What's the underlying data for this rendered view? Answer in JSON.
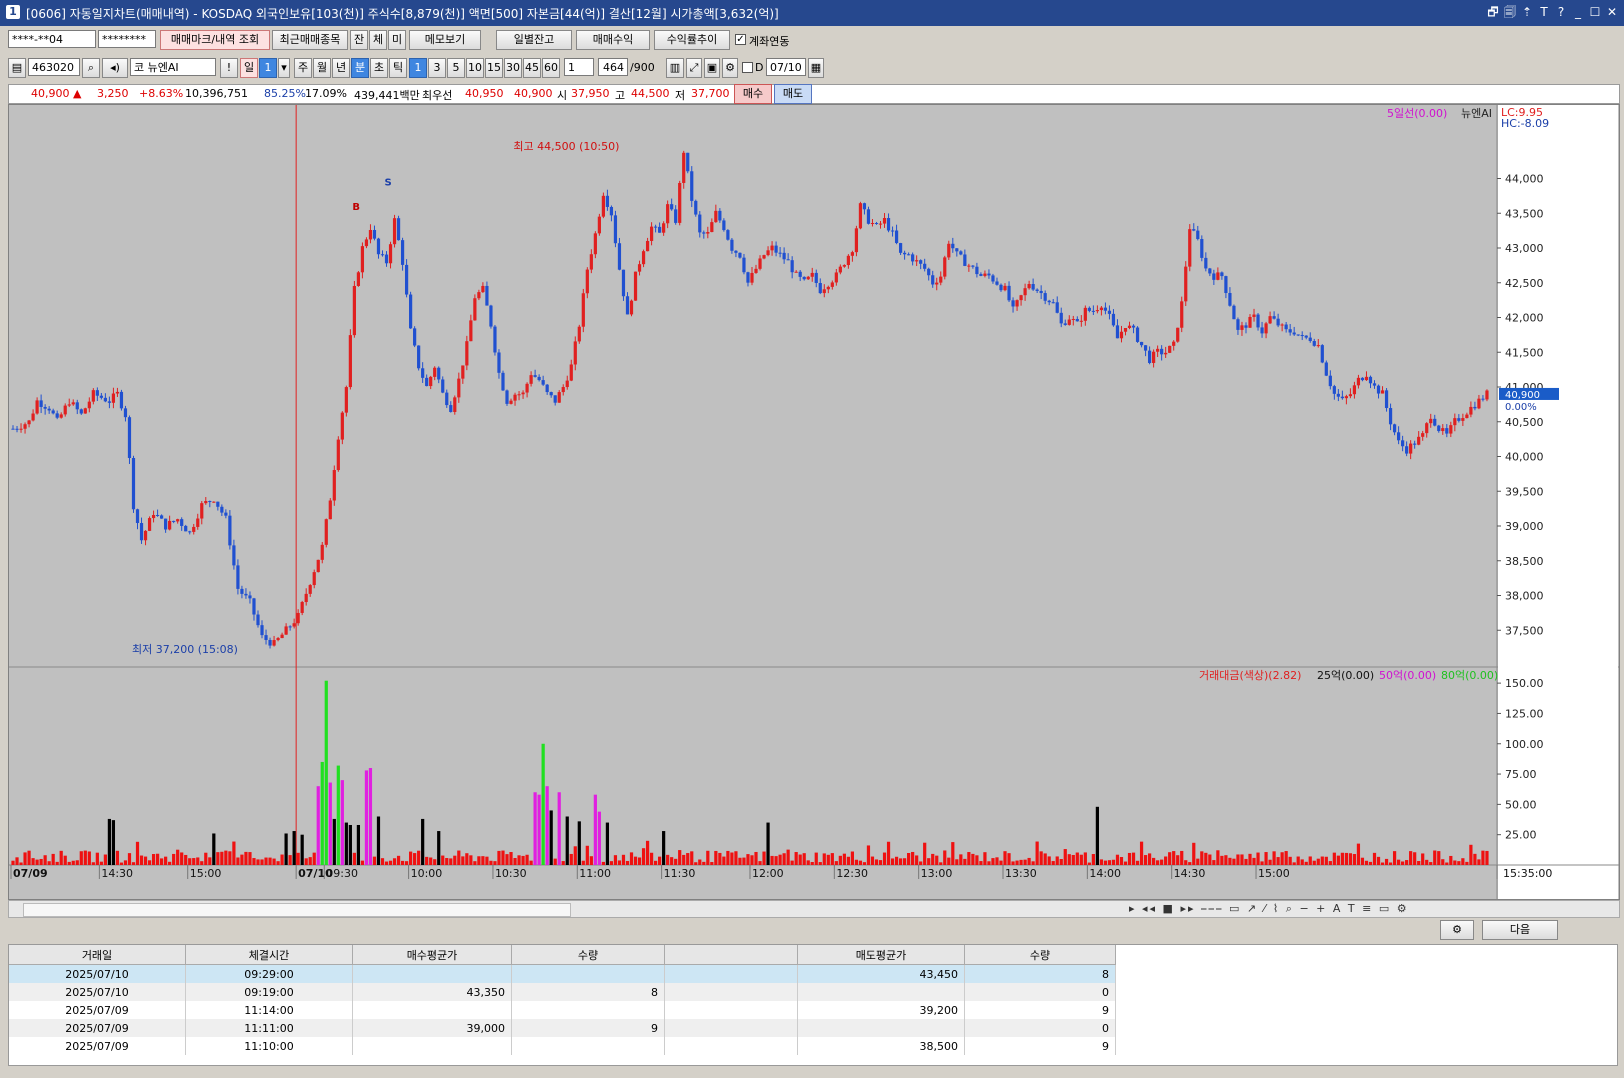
{
  "window": {
    "icon": "1",
    "title": "[0606] 자동일지차트(매매내역) - KOSDAQ 외국인보유[103(천)] 주식수[8,879(천)] 액면[500] 자본금[44(억)] 결산[12월] 시가총액[3,632(억)]",
    "buttons": [
      "🗗",
      "🗐",
      "⇡",
      "T",
      "?",
      "_",
      "☐",
      "✕"
    ]
  },
  "toolbar1": {
    "account": "****-**04",
    "password": "********",
    "mark_button": "매매마크/내역 조회",
    "recent_button": "최근매매종목",
    "small_tabs": [
      "잔",
      "체",
      "미"
    ],
    "memo_button": "메모보기",
    "daily_balance": "일별잔고",
    "trade_profit": "매매수익",
    "profit_trend": "수익률추이",
    "link_checkbox": "계좌연동",
    "link_checked": true
  },
  "toolbar2": {
    "code": "463020",
    "market": "코",
    "name": "뉴엔AI",
    "excl": "!",
    "day": "일",
    "n1": "1",
    "periods": [
      "주",
      "월",
      "년",
      "분",
      "초",
      "틱"
    ],
    "selected_period": "분",
    "minutes": [
      "1",
      "3",
      "5",
      "10",
      "15",
      "30",
      "45",
      "60"
    ],
    "selected_minute": "1",
    "count": "1",
    "display": "464",
    "display_total": "/900",
    "d_label": "D",
    "date": "07/10"
  },
  "quote": {
    "price": "40,900 ▲",
    "change": "3,250",
    "pct": "+8.63%",
    "volume": "10,396,751",
    "ratio": "85.25%",
    "turnover": "17.09%",
    "amount": "439,441백만",
    "best_label": "최우선",
    "bid": "40,950",
    "ask": "40,900",
    "open_label": "시",
    "open": "37,950",
    "high_label": "고",
    "high": "44,500",
    "low_label": "저",
    "low": "37,700",
    "buy_button": "매수",
    "sell_button": "매도"
  },
  "chart_data": [
    {
      "type": "candlestick",
      "title": "",
      "series": [
        {
          "name": "뉴엔AI"
        }
      ],
      "legend": [
        "5일선(0.00)",
        "뉴엔AI"
      ],
      "indicators": [
        "LC:9.95",
        "HC:-8.09"
      ],
      "y_ticks": [
        "44,000",
        "43,500",
        "43,000",
        "42,500",
        "42,000",
        "41,500",
        "41,000",
        "40,500",
        "40,000",
        "39,500",
        "39,000",
        "38,500",
        "38,000",
        "37,500"
      ],
      "ylim": [
        37000,
        45000
      ],
      "last": "40,900",
      "last_pct": "0.00%",
      "annotations": [
        "최고 44,500 (10:50)",
        "최저 37,200 (15:08)"
      ],
      "markers": [
        "B",
        "S"
      ],
      "price_path": [
        [
          0,
          40400
        ],
        [
          4,
          40500
        ],
        [
          6,
          40800
        ],
        [
          9,
          40700
        ],
        [
          11,
          40500
        ],
        [
          14,
          40800
        ],
        [
          17,
          40600
        ],
        [
          20,
          40900
        ],
        [
          24,
          40800
        ],
        [
          26,
          40900
        ],
        [
          28,
          40600
        ],
        [
          30,
          39300
        ],
        [
          32,
          38800
        ],
        [
          35,
          39200
        ],
        [
          38,
          39000
        ],
        [
          41,
          39100
        ],
        [
          44,
          38900
        ],
        [
          47,
          39300
        ],
        [
          50,
          39400
        ],
        [
          53,
          39100
        ],
        [
          56,
          38100
        ],
        [
          59,
          37900
        ],
        [
          62,
          37400
        ],
        [
          65,
          37300
        ],
        [
          68,
          37500
        ],
        [
          71,
          37700
        ],
        [
          74,
          38200
        ],
        [
          77,
          38700
        ],
        [
          79,
          39400
        ],
        [
          81,
          40300
        ],
        [
          83,
          41000
        ],
        [
          85,
          42400
        ],
        [
          87,
          43000
        ],
        [
          89,
          43300
        ],
        [
          91,
          42900
        ],
        [
          93,
          42800
        ],
        [
          95,
          43400
        ],
        [
          97,
          42800
        ],
        [
          99,
          41800
        ],
        [
          101,
          41300
        ],
        [
          103,
          41000
        ],
        [
          105,
          41300
        ],
        [
          107,
          40900
        ],
        [
          109,
          40700
        ],
        [
          111,
          41100
        ],
        [
          113,
          41600
        ],
        [
          115,
          42300
        ],
        [
          117,
          42400
        ],
        [
          119,
          41900
        ],
        [
          121,
          41200
        ],
        [
          123,
          40800
        ],
        [
          125,
          40900
        ],
        [
          127,
          40900
        ],
        [
          129,
          41200
        ],
        [
          131,
          41100
        ],
        [
          133,
          40900
        ],
        [
          135,
          40800
        ],
        [
          137,
          41000
        ],
        [
          139,
          41300
        ],
        [
          141,
          41900
        ],
        [
          143,
          42700
        ],
        [
          145,
          43200
        ],
        [
          147,
          43800
        ],
        [
          149,
          43500
        ],
        [
          151,
          42700
        ],
        [
          153,
          42000
        ],
        [
          155,
          42600
        ],
        [
          157,
          43000
        ],
        [
          159,
          43300
        ],
        [
          161,
          43200
        ],
        [
          163,
          43600
        ],
        [
          165,
          43400
        ],
        [
          167,
          44400
        ],
        [
          169,
          43700
        ],
        [
          171,
          43200
        ],
        [
          173,
          43200
        ],
        [
          175,
          43500
        ],
        [
          177,
          43300
        ],
        [
          179,
          43000
        ],
        [
          181,
          42900
        ],
        [
          183,
          42500
        ],
        [
          185,
          42700
        ],
        [
          187,
          42900
        ],
        [
          189,
          43000
        ],
        [
          191,
          42900
        ],
        [
          193,
          42800
        ],
        [
          195,
          42600
        ],
        [
          197,
          42500
        ],
        [
          199,
          42600
        ],
        [
          201,
          42400
        ],
        [
          203,
          42500
        ],
        [
          205,
          42600
        ],
        [
          207,
          42800
        ],
        [
          209,
          43000
        ],
        [
          211,
          43600
        ],
        [
          213,
          43400
        ],
        [
          215,
          43300
        ],
        [
          217,
          43400
        ],
        [
          219,
          43200
        ],
        [
          221,
          42900
        ],
        [
          223,
          42900
        ],
        [
          225,
          42800
        ],
        [
          227,
          42700
        ],
        [
          229,
          42500
        ],
        [
          231,
          42600
        ],
        [
          233,
          43100
        ],
        [
          235,
          42900
        ],
        [
          237,
          42800
        ],
        [
          239,
          42700
        ],
        [
          241,
          42600
        ],
        [
          243,
          42600
        ],
        [
          245,
          42500
        ],
        [
          247,
          42400
        ],
        [
          249,
          42100
        ],
        [
          251,
          42300
        ],
        [
          253,
          42500
        ],
        [
          255,
          42400
        ],
        [
          257,
          42300
        ],
        [
          259,
          42200
        ],
        [
          261,
          41900
        ],
        [
          263,
          42000
        ],
        [
          265,
          41900
        ],
        [
          267,
          42100
        ],
        [
          269,
          42100
        ],
        [
          271,
          42200
        ],
        [
          273,
          42000
        ],
        [
          275,
          41700
        ],
        [
          277,
          41900
        ],
        [
          279,
          41800
        ],
        [
          281,
          41600
        ],
        [
          283,
          41400
        ],
        [
          285,
          41500
        ],
        [
          287,
          41500
        ],
        [
          289,
          41600
        ],
        [
          291,
          42200
        ],
        [
          293,
          43300
        ],
        [
          295,
          43100
        ],
        [
          297,
          42700
        ],
        [
          299,
          42600
        ],
        [
          301,
          42600
        ],
        [
          303,
          42200
        ],
        [
          305,
          41800
        ],
        [
          307,
          41900
        ],
        [
          309,
          42000
        ],
        [
          311,
          41800
        ],
        [
          313,
          42000
        ],
        [
          315,
          41900
        ],
        [
          317,
          41800
        ],
        [
          319,
          41800
        ],
        [
          321,
          41700
        ],
        [
          323,
          41700
        ],
        [
          325,
          41600
        ],
        [
          327,
          41200
        ],
        [
          329,
          40900
        ],
        [
          331,
          40800
        ],
        [
          333,
          40900
        ],
        [
          335,
          41100
        ],
        [
          337,
          41200
        ],
        [
          339,
          41000
        ],
        [
          341,
          40900
        ],
        [
          343,
          40500
        ],
        [
          345,
          40200
        ],
        [
          347,
          40100
        ],
        [
          349,
          40200
        ],
        [
          351,
          40300
        ],
        [
          353,
          40600
        ],
        [
          355,
          40400
        ],
        [
          357,
          40300
        ],
        [
          359,
          40500
        ],
        [
          361,
          40600
        ],
        [
          363,
          40700
        ],
        [
          365,
          40800
        ],
        [
          367,
          40900
        ]
      ],
      "x_labels": [
        "07/09",
        "14:30",
        "15:00",
        "07/10",
        "09:30",
        "10:00",
        "10:30",
        "11:00",
        "11:30",
        "12:00",
        "12:30",
        "13:00",
        "13:30",
        "14:00",
        "14:30",
        "15:00",
        "15:35:00"
      ]
    },
    {
      "type": "bar",
      "title": "",
      "legend": [
        "거래대금(색상)(2.82)",
        "25억(0.00)",
        "50억(0.00)",
        "80억(0.00)"
      ],
      "ylim": [
        0,
        160
      ],
      "y_ticks": [
        "150.00",
        "125.00",
        "100.00",
        "75.00",
        "50.00",
        "25.00"
      ],
      "spikes": [
        [
          24,
          38,
          "black"
        ],
        [
          25,
          37,
          "black"
        ],
        [
          50,
          26,
          "black"
        ],
        [
          68,
          26,
          "black"
        ],
        [
          70,
          28,
          "black"
        ],
        [
          72,
          25,
          "black"
        ],
        [
          76,
          65,
          "magenta"
        ],
        [
          77,
          85,
          "green"
        ],
        [
          78,
          152,
          "green"
        ],
        [
          79,
          68,
          "magenta"
        ],
        [
          80,
          38,
          "black"
        ],
        [
          81,
          82,
          "green"
        ],
        [
          82,
          70,
          "magenta"
        ],
        [
          83,
          35,
          "black"
        ],
        [
          84,
          33,
          "black"
        ],
        [
          86,
          33,
          "black"
        ],
        [
          88,
          78,
          "magenta"
        ],
        [
          89,
          80,
          "magenta"
        ],
        [
          91,
          40,
          "black"
        ],
        [
          102,
          38,
          "black"
        ],
        [
          106,
          28,
          "black"
        ],
        [
          130,
          60,
          "magenta"
        ],
        [
          131,
          58,
          "magenta"
        ],
        [
          132,
          100,
          "green"
        ],
        [
          133,
          65,
          "magenta"
        ],
        [
          134,
          45,
          "black"
        ],
        [
          136,
          60,
          "magenta"
        ],
        [
          138,
          40,
          "black"
        ],
        [
          141,
          36,
          "black"
        ],
        [
          145,
          58,
          "magenta"
        ],
        [
          146,
          44,
          "magenta"
        ],
        [
          148,
          35,
          "black"
        ],
        [
          162,
          28,
          "black"
        ],
        [
          188,
          35,
          "black"
        ],
        [
          270,
          48,
          "black"
        ]
      ]
    }
  ],
  "bottom": {
    "settings": "⚙",
    "next": "다음"
  },
  "table": {
    "headers": [
      "거래일",
      "체결시간",
      "매수평균가",
      "수량",
      "",
      "매도평균가",
      "수량"
    ],
    "rows": [
      [
        "2025/07/10",
        "09:29:00",
        "",
        "",
        "",
        "43,450",
        "8"
      ],
      [
        "2025/07/10",
        "09:19:00",
        "43,350",
        "8",
        "",
        "",
        "0"
      ],
      [
        "2025/07/09",
        "11:14:00",
        "",
        "",
        "",
        "39,200",
        "9"
      ],
      [
        "2025/07/09",
        "11:11:00",
        "39,000",
        "9",
        "",
        "",
        "0"
      ],
      [
        "2025/07/09",
        "11:10:00",
        "",
        "",
        "",
        "38,500",
        "9"
      ]
    ]
  }
}
